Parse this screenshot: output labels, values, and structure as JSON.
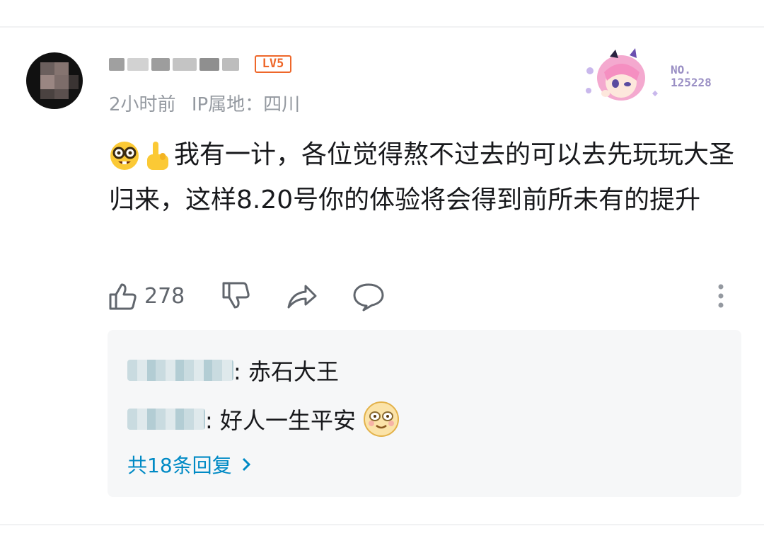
{
  "comment": {
    "level_badge": "LV5",
    "time": "2小时前",
    "ip_location": "IP属地：四川",
    "fan_badge": {
      "line1": "NO.",
      "line2": "125228"
    },
    "text": "我有一计，各位觉得熬不过去的可以去先玩玩大圣归来，这样8.20号你的体验将会得到前所未有的提升",
    "emojis": [
      "nerd-face",
      "pointing-up"
    ],
    "like_count": "278"
  },
  "replies": [
    {
      "text": ": 赤石大王"
    },
    {
      "text": ": 好人一生平安"
    }
  ],
  "replies_more": "共18条回复"
}
